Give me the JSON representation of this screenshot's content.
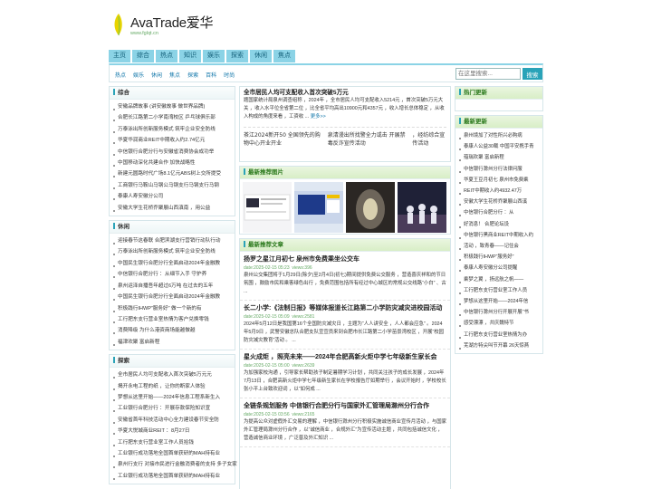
{
  "header": {
    "site_title": "AvaTrade爱华",
    "site_url": "www.fglqt.cn"
  },
  "nav": [
    "主页",
    "综合",
    "热点",
    "知识",
    "娱乐",
    "探索",
    "休闲",
    "焦点"
  ],
  "subnav": [
    "热点",
    "娱乐",
    "休闲",
    "焦点",
    "探索",
    "百科",
    "时尚"
  ],
  "search": {
    "placeholder": "在这里搜索...",
    "button": "搜索"
  },
  "left": {
    "sections": [
      {
        "title": "综合",
        "items": [
          "安徽品牌故事 (讲安徽故事 做世界品牌)",
          "合肥长江路第二小学南湾校区 乒乓球俱乐部",
          "万泰泳出所创新服务模式 筑牢企业安全防线",
          "华夏华润商业REIT中期收入约2.74亿元",
          "中信银行合肥分行与安徽省消费协会成功举",
          "中国移动深化共建合作        加快战略性",
          "新建元圆路时代广场8.1亿元ABS树上交所提受",
          "工商银行马鞍山马钢公马钢支行马钢支行马钢",
          "泰康人寿安徽分公司",
          "安徽大学生花桥乔聚展山西滇南       ，用公益"
        ]
      },
      {
        "title": "休闲",
        "items": [
          "迎接春节这春联 合肥滨湖支行营销行动队行动",
          "万泰泳出所创新服务模式 筑牢企业安全防线",
          "中国民生银行合肥分行全面启动2024年金融教",
          "中信银行合肥分行     ：从细节入手 守护养",
          "泉州运泽自播吾年超过6万吨 在过去的五年",
          "中国民生银行合肥分行全面启动2024年金融教",
          "积极践行IHWP“服务好”        做一个新的有",
          "工行肥东支行营业室热情为客户兑换零钱",
          "消费降级        为什么港资商场能越做越",
          "福津欢聚 富启新程"
        ]
      },
      {
        "title": "探索",
        "items": [
          "全市居民人均可支配收入首次突破5万元元",
          "揭开永电工程的纸      ，让你的断家人体验",
          "梦想从这里开始——2024年信息工程系新生入",
          "工业银行合肥分行         ：开展存款保险知识宣",
          "安徽省首年科技活动中心全力建设春节安全防",
          "华夏大悦城商业REIT         ：8月27日",
          "工行肥东支行营业室工作人员拾钱",
          "工业银行成功落地全国首单获研的MAH持有业",
          "泉州行支行 对接市民进行金融消费者的支持 多子女家",
          "工业银行成功落地全国首单获研的MAH持有业"
        ]
      }
    ]
  },
  "mid": {
    "hot_title": "全市居民人均可支配收入首次突破5万元",
    "hot_text": "题国家统计局泉州调查组称            ，2024年            ，全市居民人均可支配收入5214元        ，首次突破5万元大关        ，收入水平位全省第二位        ，比全省平均高出10900元和4357元        ，收入增长总体稳定        ，从收入构成的角度来看        ，工资收 ...",
    "hot_more": "更多>>",
    "hot_links": [
      "茶江2024新开50 全国领先的购物中心开业开业",
      "泉清漫出所找警全力或击 开展禁毒反诈宣传活动",
      "，经纺综合宣传活动"
    ],
    "images_title": "最新推荐图片",
    "articles_title": "最新推荐文章",
    "articles": [
      {
        "title": "扬罗之星江月初七  泉州市免费乘坐公交车",
        "date": "date:2025-02-15 05:23",
        "views": "views:396",
        "summary": "泉州公交集团将于1月29日(除夕)至2月4日(初七)期间提供免费公交服务        ，营造喜庆祥和的节日氛围        ，鼓励市民和乘客绿色出行        ，免费范围包括所有经过中心城区的常规公交线路“小白”        、古 ..."
      },
      {
        "title": "长二小学:《法制日报》等媒体报道长江路第二小学防灾减灾进校园活动",
        "date": "date:2025-02-15 05:09",
        "views": "views:2581",
        "summary": "2024年5月12日是我国第16个全国防灾减灾日        ，主题为“人人讲安全        ，人人都会应急”        。2024年5月9日        ，武警安徽总队合肥支队宣宣员来到合肥市长江路第二小学苗景湾校区        ，开展“校园防灾减灾教育”活动        。 ..."
      },
      {
        "title": "星火成炬        ，照亮未来——2024年合肥高新火炬中学七年级新生家长会",
        "date": "date:2025-02-15 05:00",
        "views": "views:2639",
        "summary": "为加强家校沟通        ，引导家长帮助孩子制定暑期学习计划        ，共同关注孩子的成长发展        ，2024年7月13日        ，合肥高新火炬中学七年级新生家长在学校报告厅如期举行        ，会议开始时        ，学校校长张小平上台致欢迎词        ，以“如何成 ..."
      },
      {
        "title": "全链条规划服务 中信银行合肥分行与国家外汇管理局滁州分行合作",
        "date": "date:2025-02-15 03:56",
        "views": "views:2165",
        "summary": "为提高公众对虚假外汇交易的理解        ，中信银行滁州分行积极实施诚信商业宣传月活动        ，与国家外汇管理局滁州分行合作        ，以“诚信商业        ，合规外汇”为宣传活动主题        ，共同包括诚信文化        ，营造诚信商业环境        ，广泛普及外汇知识 ..."
      }
    ]
  },
  "right": {
    "hot_update_title": "热门更新",
    "latest_title": "最新更新",
    "latest_items": [
      "泉州境加了对性所兴必购病",
      "泰康人公益30载 中国平安携手青",
      "蕴瑞欢聚 富启新程",
      "中信银行滁州分行法律问服",
      "华夏王豆月初七 泉州市免费乘",
      "REIT中期收入约4932.47万",
      "安徽大学生花桥乔聚展山西溪",
      "中信银行合肥分行        ：从",
      "好消息！     合肥论坛设",
      "中信银行黑商业REIT中期收入约",
      "活动        ，致青春——记住会",
      "积极践行IHWP“服务好”",
      "泰康人寿安徽分公司提醒",
      "乘梦之翼        ，扬远航之帆——",
      "工行肥东支行营业室工作人员",
      "梦想从这里开始——2024年信",
      "中信银行滁州分行开展开展“书",
      "感受漂漂        ，共庆魏特节",
      "工行肥东支行营业室热情为办",
      "芜湖方特尖叫节开幕 26天惊燕"
    ]
  },
  "colors": {
    "nav_bg": "#8bd3e6",
    "accent": "#2aa3b8",
    "green_text": "#2c7a1d"
  }
}
